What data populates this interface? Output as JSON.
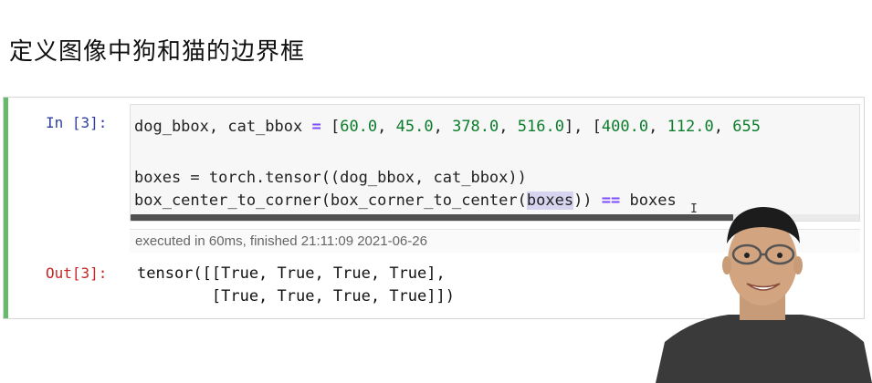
{
  "heading": "定义图像中狗和猫的边界框",
  "cell": {
    "in_prompt": "In [3]:",
    "out_prompt": "Out[3]:",
    "code": {
      "line1": {
        "a": "dog_bbox, cat_bbox ",
        "op": "=",
        "b": " [",
        "n1": "60.0",
        "c1": ", ",
        "n2": "45.0",
        "c2": ", ",
        "n3": "378.0",
        "c3": ", ",
        "n4": "516.0",
        "c4": "], [",
        "n5": "400.0",
        "c5": ", ",
        "n6": "112.0",
        "c6": ", ",
        "n7": "655"
      },
      "line2": "boxes = torch.tensor((dog_bbox, cat_bbox))",
      "line3": {
        "a": "box_center_to_corner(box_corner_to_center(",
        "hl": "boxes",
        "b": ")) ",
        "op": "==",
        "c": " boxes"
      }
    },
    "execution_info": "executed in 60ms, finished 21:11:09 2021-06-26",
    "output": {
      "line1": "tensor([[True, True, True, True],",
      "line2": "        [True, True, True, True]])"
    }
  },
  "colors": {
    "cell_bar": "#66bb6a",
    "in_prompt": "#303f9f",
    "out_prompt": "#c62828",
    "number": "#0b7d2b",
    "operator": "#7c4dff"
  }
}
